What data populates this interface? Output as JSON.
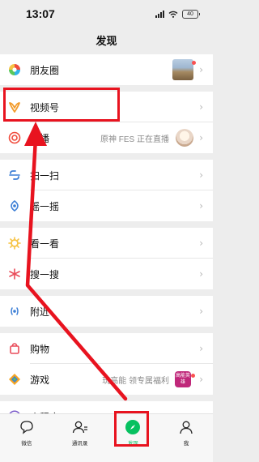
{
  "status_bar": {
    "time": "13:07",
    "battery": "40"
  },
  "header": {
    "title": "发现"
  },
  "menu": {
    "moments": {
      "label": "朋友圈"
    },
    "channels": {
      "label": "视频号"
    },
    "live": {
      "label": "直播",
      "right_text": "原神 FES 正在直播"
    },
    "scan": {
      "label": "扫一扫"
    },
    "shake": {
      "label": "摇一摇"
    },
    "top_stories": {
      "label": "看一看"
    },
    "search": {
      "label": "搜一搜"
    },
    "nearby": {
      "label": "附近"
    },
    "shop": {
      "label": "购物"
    },
    "games": {
      "label": "游戏",
      "right_text": "玩高能 领专属福利",
      "badge_text": "高能英雄"
    },
    "mini_programs": {
      "label": "小程序"
    }
  },
  "tab_bar": {
    "tabs": [
      {
        "label": "微信",
        "icon": "chat-bubble-icon"
      },
      {
        "label": "通讯录",
        "icon": "contacts-icon"
      },
      {
        "label": "发现",
        "icon": "compass-icon",
        "active": true
      },
      {
        "label": "我",
        "icon": "person-icon"
      }
    ]
  },
  "colors": {
    "accent": "#07c160",
    "annotation_red": "#e8131f",
    "background": "#ededed"
  }
}
